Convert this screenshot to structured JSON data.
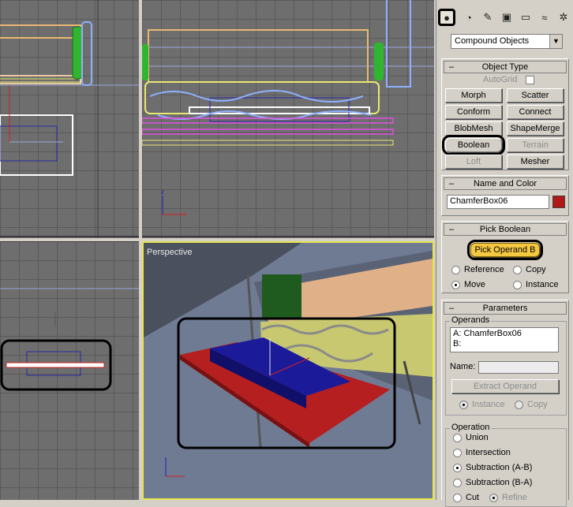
{
  "viewports": {
    "perspective_label": "Perspective"
  },
  "panel": {
    "tab_icons": [
      "geometry-icon",
      "shapes-icon",
      "lights-icon",
      "cameras-icon",
      "helpers-icon",
      "spacewarps-icon",
      "systems-icon"
    ],
    "category_dropdown": "Compound Objects",
    "object_type": {
      "title": "Object Type",
      "autogrid": "AutoGrid",
      "buttons": [
        "Morph",
        "Scatter",
        "Conform",
        "Connect",
        "BlobMesh",
        "ShapeMerge",
        "Boolean",
        "Terrain",
        "Loft",
        "Mesher"
      ]
    },
    "name_color": {
      "title": "Name and Color",
      "name_value": "ChamferBox06",
      "color": "#b01818"
    },
    "pick_boolean": {
      "title": "Pick Boolean",
      "button": "Pick Operand B",
      "reference": "Reference",
      "copy": "Copy",
      "move": "Move",
      "instance": "Instance"
    },
    "parameters": {
      "title": "Parameters",
      "operands_label": "Operands",
      "operand_a": "A: ChamferBox06",
      "operand_b": "B:",
      "name_label": "Name:",
      "extract_button": "Extract Operand",
      "instance": "Instance",
      "copy": "Copy",
      "operation_label": "Operation",
      "ops": [
        "Union",
        "Intersection",
        "Subtraction (A-B)",
        "Subtraction (B-A)",
        "Cut"
      ],
      "refine": "Refine"
    }
  }
}
